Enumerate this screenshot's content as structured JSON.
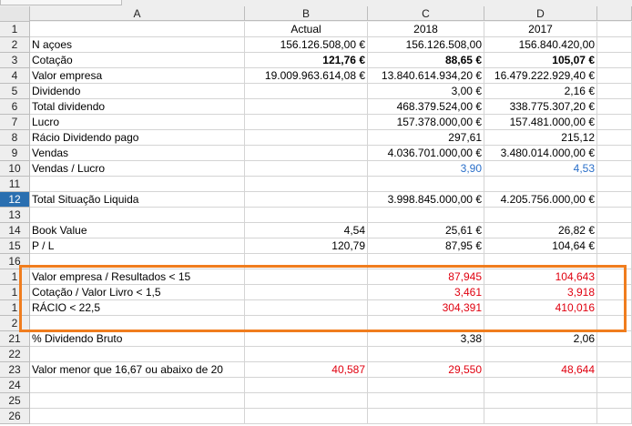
{
  "columns": [
    "A",
    "B",
    "C",
    "D"
  ],
  "colors": {
    "blue_value": "#2a6fc9",
    "red_value": "#e0000f",
    "highlight": "#f07d1e",
    "selected_row": "#2a6fb0"
  },
  "rows": [
    {
      "n": "1",
      "a": "",
      "b": "Actual",
      "c": "2018",
      "d": "2017",
      "align": "center"
    },
    {
      "n": "2",
      "a": "N açoes",
      "b": "156.126.508,00 €",
      "c": "156.126.508,00",
      "d": "156.840.420,00"
    },
    {
      "n": "3",
      "a": "Cotação",
      "b": "121,76 €",
      "c": "88,65 €",
      "d": "105,07 €",
      "bold": true
    },
    {
      "n": "4",
      "a": "Valor empresa",
      "b": "19.009.963.614,08 €",
      "c": "13.840.614.934,20 €",
      "d": "16.479.222.929,40 €"
    },
    {
      "n": "5",
      "a": "Dividendo",
      "b": "",
      "c": "3,00 €",
      "d": "2,16 €"
    },
    {
      "n": "6",
      "a": "Total dividendo",
      "b": "",
      "c": "468.379.524,00 €",
      "d": "338.775.307,20 €"
    },
    {
      "n": "7",
      "a": "Lucro",
      "b": "",
      "c": "157.378.000,00 €",
      "d": "157.481.000,00 €"
    },
    {
      "n": "8",
      "a": "Rácio Dividendo pago",
      "b": "",
      "c": "297,61",
      "d": "215,12"
    },
    {
      "n": "9",
      "a": "Vendas",
      "b": "",
      "c": "4.036.701.000,00 €",
      "d": "3.480.014.000,00 €"
    },
    {
      "n": "10",
      "a": "Vendas / Lucro",
      "b": "",
      "c": "3,90",
      "d": "4,53",
      "color": "blue"
    },
    {
      "n": "11",
      "a": "",
      "b": "",
      "c": "",
      "d": ""
    },
    {
      "n": "12",
      "a": "Total Situação Liquida",
      "b": "",
      "c": "3.998.845.000,00 €",
      "d": "4.205.756.000,00 €",
      "selected": true
    },
    {
      "n": "13",
      "a": "",
      "b": "",
      "c": "",
      "d": ""
    },
    {
      "n": "14",
      "a": "Book Value",
      "b": "4,54",
      "c": "25,61 €",
      "d": "26,82 €"
    },
    {
      "n": "15",
      "a": "P / L",
      "b": "120,79",
      "c": "87,95 €",
      "d": "104,64 €"
    },
    {
      "n": "16",
      "a": "",
      "b": "",
      "c": "",
      "d": ""
    },
    {
      "n": "1",
      "a": "Valor empresa / Resultados < 15",
      "b": "",
      "c": "87,945",
      "d": "104,643",
      "color": "red"
    },
    {
      "n": "1",
      "a": "Cotação / Valor Livro < 1,5",
      "b": "",
      "c": "3,461",
      "d": "3,918",
      "color": "red"
    },
    {
      "n": "1",
      "a": "RÁCIO < 22,5",
      "b": "",
      "c": "304,391",
      "d": "410,016",
      "color": "red"
    },
    {
      "n": "2",
      "a": "",
      "b": "",
      "c": "",
      "d": ""
    },
    {
      "n": "21",
      "a": "% Dividendo Bruto",
      "b": "",
      "c": "3,38",
      "d": "2,06"
    },
    {
      "n": "22",
      "a": "",
      "b": "",
      "c": "",
      "d": ""
    },
    {
      "n": "23",
      "a": "Valor menor que 16,67 ou abaixo de 20",
      "b": "40,587",
      "c": "29,550",
      "d": "48,644",
      "color": "red"
    },
    {
      "n": "24",
      "a": "",
      "b": "",
      "c": "",
      "d": ""
    },
    {
      "n": "25",
      "a": "",
      "b": "",
      "c": "",
      "d": ""
    },
    {
      "n": "26",
      "a": "",
      "b": "",
      "c": "",
      "d": ""
    }
  ]
}
